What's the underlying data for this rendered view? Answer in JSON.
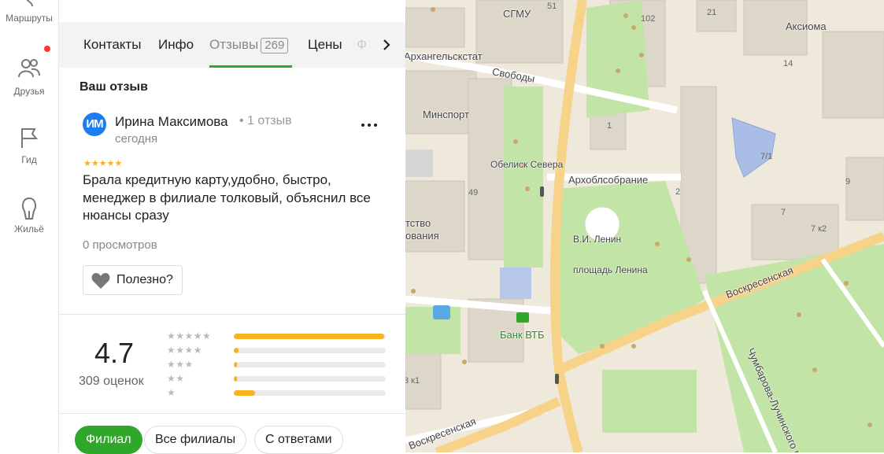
{
  "rail": {
    "routes": "Маршруты",
    "friends": "Друзья",
    "guide": "Гид",
    "housing": "Жильё"
  },
  "tabs": {
    "contacts": "Контакты",
    "info": "Инфо",
    "reviews": "Отзывы",
    "reviews_count": "269",
    "prices": "Цены",
    "faded": "Ф"
  },
  "review": {
    "section_title": "Ваш отзыв",
    "avatar_initials": "ИМ",
    "author": "Ирина Максимова",
    "author_meta": "• 1 отзыв",
    "date": "сегодня",
    "stars": "★★★★★",
    "rating": 5,
    "text": "Брала кредитную карту,удобно, быстро, менеджер в филиале толковый, объяснил все нюансы сразу",
    "views": "0 просмотров",
    "useful": "Полезно?"
  },
  "rating": {
    "value": "4.7",
    "count": "309 оценок",
    "distribution": [
      {
        "stars": "★★★★★",
        "share": 0.99
      },
      {
        "stars": "★★★★",
        "share": 0.03
      },
      {
        "stars": "★★★",
        "share": 0.02
      },
      {
        "stars": "★★",
        "share": 0.02
      },
      {
        "stars": "★",
        "share": 0.14
      }
    ]
  },
  "filters": {
    "branch": "Филиал",
    "all_branches": "Все филиалы",
    "with_answers": "С ответами"
  },
  "map": {
    "labels": {
      "sgmu": "СГМУ",
      "arkhangelskstat": "Архангельскстат",
      "svobody": "Свободы",
      "minsport": "Минспорт",
      "obelisk": "Обелиск Севера",
      "arkhoblsobranie": "Архоблсобрание",
      "lenin": "В.И. Ленин",
      "lenin_square": "площадь Ленина",
      "aksioma": "Аксиома",
      "voskresenskaya": "Воскресенская",
      "voskresenskaya2": "Воскресенская",
      "bank_vtb": "Банк ВТБ",
      "chumbarova": "Чумбарова-Лучинского пр",
      "agency": "тство",
      "agency2": "ования"
    },
    "numbers": {
      "n51": "51",
      "n102": "102",
      "n21": "21",
      "n14": "14",
      "n1": "1",
      "n49": "49",
      "n2": "2",
      "n71": "7/1",
      "n9": "9",
      "n7": "7",
      "n7k2": "7 к2",
      "n3k1": "3 к1"
    },
    "colors": {
      "park": "#bfe3a3",
      "road_main": "#f7d38a",
      "building": "#dcd7cc"
    }
  }
}
